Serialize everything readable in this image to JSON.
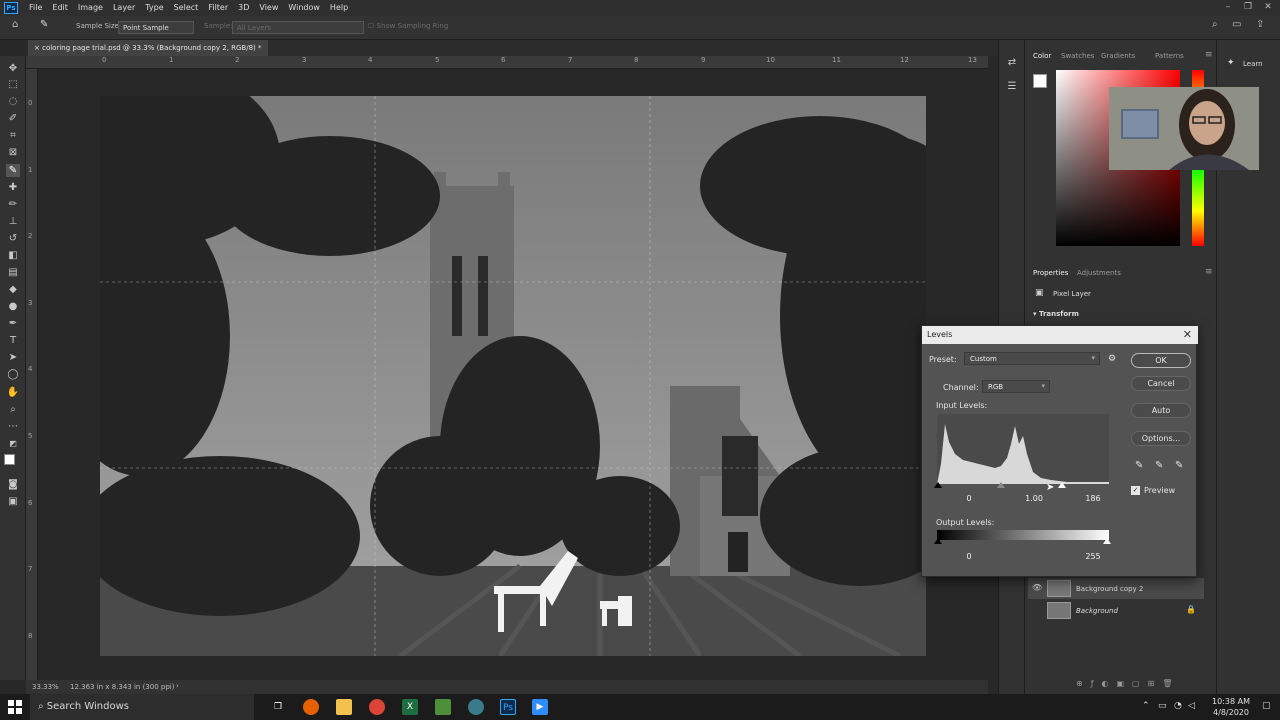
{
  "menubar": {
    "app_logo": "Ps",
    "items": [
      "File",
      "Edit",
      "Image",
      "Layer",
      "Type",
      "Select",
      "Filter",
      "3D",
      "View",
      "Window",
      "Help"
    ]
  },
  "options_bar": {
    "sample_size_label": "Sample Size:",
    "sample_size_value": "Point Sample",
    "sample_label": "Sample:",
    "sample_value": "All Layers",
    "show_ring": "Show Sampling Ring"
  },
  "document": {
    "tab_title": "coloring page trial.psd @ 33.3% (Background copy 2, RGB/8) *"
  },
  "ruler": {
    "top_ticks": [
      "0",
      "1",
      "2",
      "3",
      "4",
      "5",
      "6",
      "7",
      "8",
      "9",
      "10",
      "11",
      "12",
      "13"
    ],
    "left_ticks": [
      "0",
      "1",
      "2",
      "3",
      "4",
      "5",
      "6",
      "7",
      "8"
    ]
  },
  "status": {
    "zoom": "33.33%",
    "doc_size": "12.363 in x 8.343 in (300 ppi)"
  },
  "panels": {
    "color_tabs": [
      "Color",
      "Swatches",
      "Gradients",
      "Patterns"
    ],
    "learn_tab": "Learn",
    "properties_tabs": [
      "Properties",
      "Adjustments"
    ],
    "pixel_layer": "Pixel Layer",
    "transform": "Transform",
    "layers": [
      {
        "name": "Background copy 2",
        "selected": true
      },
      {
        "name": "Background",
        "selected": false
      }
    ],
    "colors": {
      "fg": "#ffffff",
      "bg": "#000000",
      "picker_hue": "#ff0000"
    }
  },
  "levels": {
    "title": "Levels",
    "preset_label": "Preset:",
    "preset_value": "Custom",
    "channel_label": "Channel:",
    "channel_value": "RGB",
    "input_levels_label": "Input Levels:",
    "input_black": "0",
    "input_gamma": "1.00",
    "input_white": "186",
    "output_levels_label": "Output Levels:",
    "output_black": "0",
    "output_white": "255",
    "ok": "OK",
    "cancel": "Cancel",
    "auto": "Auto",
    "options": "Options...",
    "preview_label": "Preview",
    "preview_checked": true
  },
  "taskbar": {
    "search_placeholder": "Search Windows",
    "time": "10:38 AM",
    "date": "4/8/2020"
  }
}
